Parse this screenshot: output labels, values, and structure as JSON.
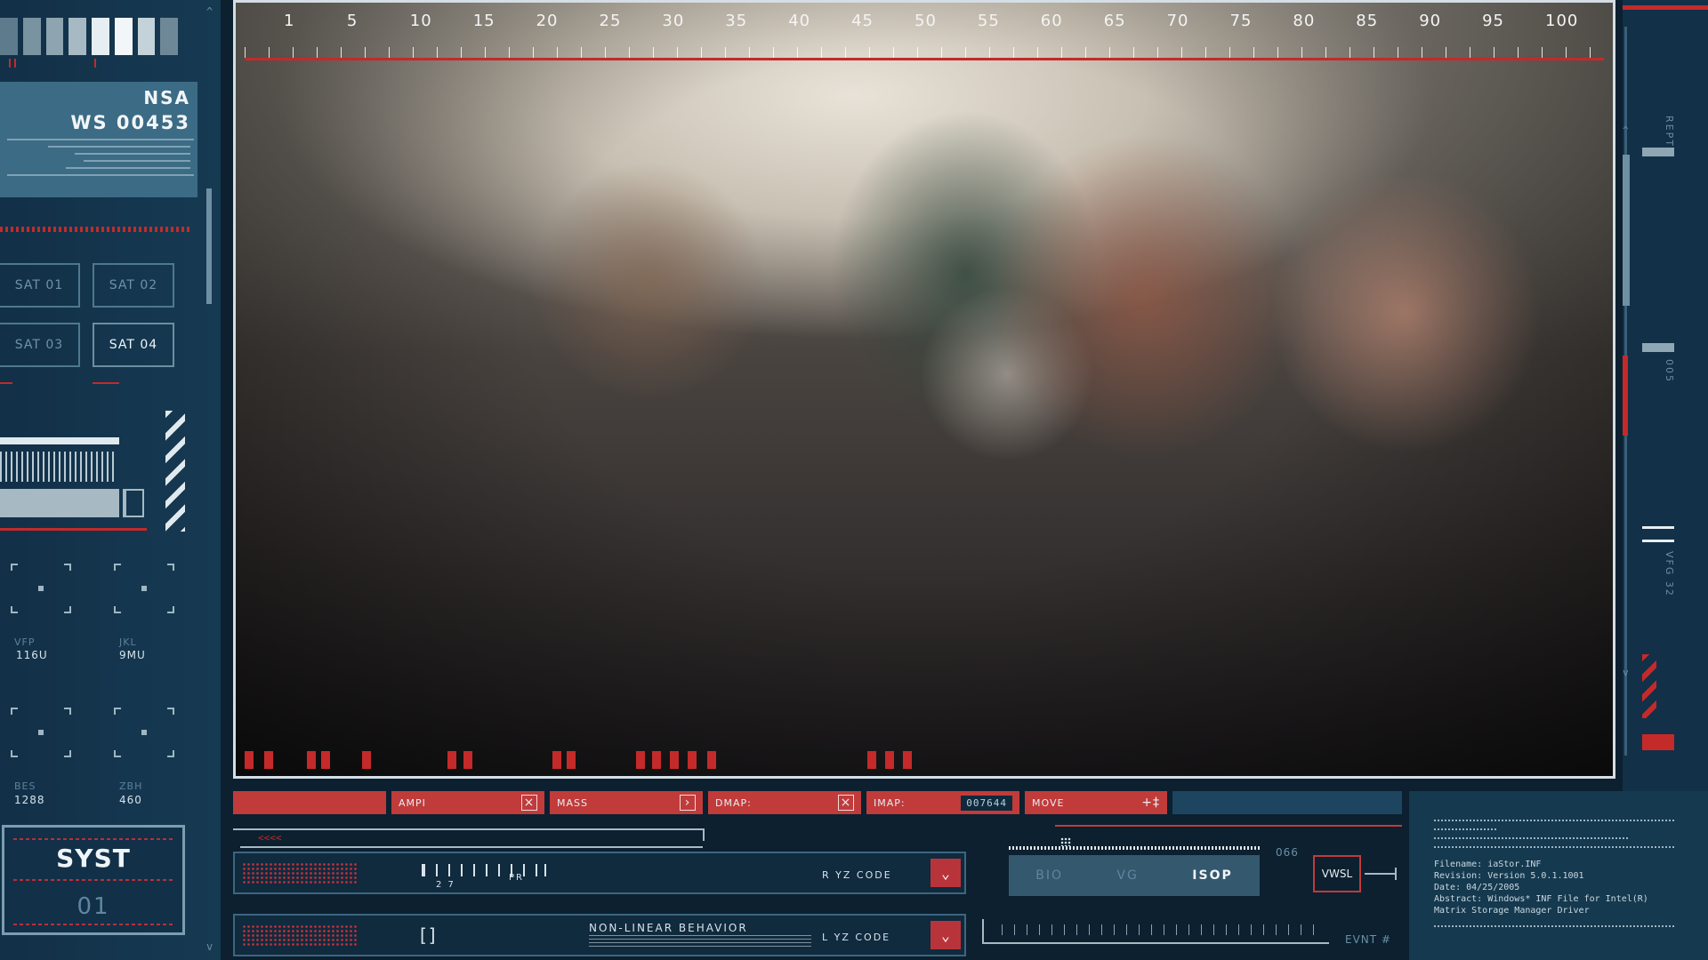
{
  "colors": {
    "accent": "#c13b3b",
    "panel": "#123048",
    "highlight": "#3c6b85"
  },
  "left": {
    "info": {
      "agency": "NSA",
      "station": "WS 00453"
    },
    "satellites": [
      {
        "label": "SAT 01",
        "active": false
      },
      {
        "label": "SAT 02",
        "active": false
      },
      {
        "label": "SAT 03",
        "active": false
      },
      {
        "label": "SAT 04",
        "active": true
      }
    ],
    "readouts": [
      {
        "label": "VFP",
        "value": "116U"
      },
      {
        "label": "JKL",
        "value": "9MU"
      },
      {
        "label": "BES",
        "value": "1288"
      },
      {
        "label": "ZBH",
        "value": "460"
      }
    ],
    "system": {
      "title": "SYST",
      "number": "01"
    }
  },
  "view": {
    "ruler": [
      "1",
      "5",
      "10",
      "15",
      "20",
      "25",
      "30",
      "35",
      "40",
      "45",
      "50",
      "55",
      "60",
      "65",
      "70",
      "75",
      "80",
      "85",
      "90",
      "95",
      "100"
    ]
  },
  "right": {
    "labels": [
      "REPT",
      "005",
      "VFG 32"
    ]
  },
  "toolbar": {
    "ampi": "AMPI",
    "mass": "MASS",
    "dmap": "DMAP:",
    "imap": "IMAP:",
    "imap_value": "007644",
    "move": "MOVE",
    "move_icon": "+‡"
  },
  "controls": {
    "arrows": "<<<<",
    "scale_nums": "2 7",
    "scale_label": "PR",
    "row1_code": "R YZ CODE",
    "row2_title": "NON-LINEAR BEHAVIOR",
    "row2_code": "L YZ CODE",
    "bracket_icon": "[]",
    "count": "066",
    "bio": "BIO",
    "vg": "VG",
    "isop": "ISOP",
    "vwsl": "VWSL",
    "evnt": "EVNT #"
  },
  "log": {
    "filename": "Filename:   iaStor.INF",
    "revision": "Revision:   Version 5.0.1.1001",
    "date": "Date:       04/25/2005",
    "abstract": "Abstract:   Windows* INF File for Intel(R)",
    "driver": "Matrix Storage Manager Driver"
  }
}
